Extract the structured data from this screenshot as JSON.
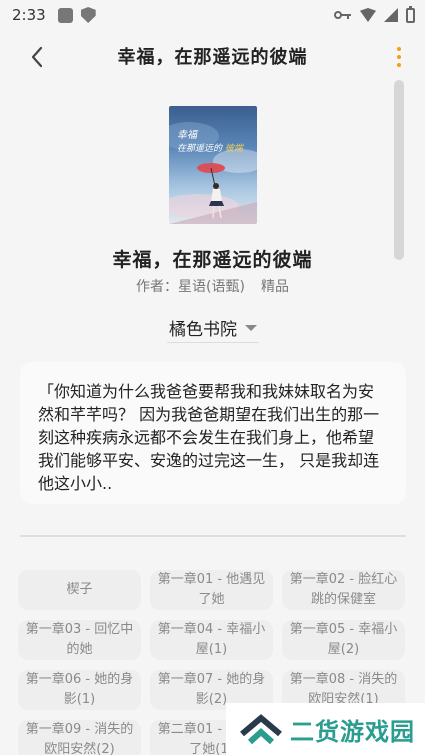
{
  "status_bar": {
    "time": "2:33"
  },
  "header": {
    "title": "幸福，在那遥远的彼端"
  },
  "book": {
    "cover_text_line1": "幸福",
    "cover_text_line2a": "在那遥远的",
    "cover_text_line2b": "彼端",
    "title": "幸福，在那遥远的彼端",
    "author": "作者：星语(语甄)",
    "tag": "精品"
  },
  "source": {
    "selected": "橘色书院"
  },
  "summary": "「你知道为什么我爸爸要帮我和我妹妹取名为安然和芊芊吗？ 因为我爸爸期望在我们出生的那一刻这种疾病永远都不会发生在我们身上，他希望我们能够平安、安逸的过完这一生， 只是我却连他这小小..",
  "chapters": [
    "楔子",
    "第一章01 - 他遇见了她",
    "第一章02 - 脸红心跳的保健室",
    "第一章03 - 回忆中的她",
    "第一章04 - 幸福小屋(1)",
    "第一章05 - 幸福小屋(2)",
    "第一章06 - 她的身影(1)",
    "第一章07 - 她的身影(2)",
    "第一章08 - 消失的欧阳安然(1)",
    "第一章09 - 消失的欧阳安然(2)",
    "第二章01 - 他遇见了她(1)",
    ""
  ],
  "watermark": {
    "text": "二货游戏园"
  },
  "colors": {
    "accent": "#f2a01e",
    "watermark": "#2a9d8f"
  }
}
